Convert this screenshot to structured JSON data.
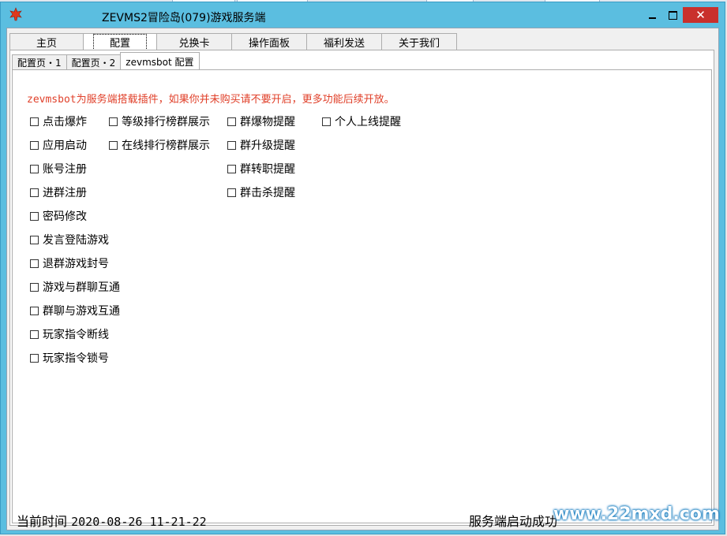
{
  "window": {
    "title": "ZEVMS2冒险岛(079)游戏服务端",
    "close_symbol": "✕"
  },
  "main_tabs": [
    {
      "label": "主页"
    },
    {
      "label": "配置"
    },
    {
      "label": "兑换卡"
    },
    {
      "label": "操作面板"
    },
    {
      "label": "福利发送"
    },
    {
      "label": "关于我们"
    }
  ],
  "sub_tabs": [
    {
      "label": "配置页・1"
    },
    {
      "label": "配置页・2"
    },
    {
      "label": "zevmsbot 配置"
    }
  ],
  "notice": "zevmsbot为服务端搭载插件，如果你并未购买请不要开启，更多功能后续开放。",
  "options": {
    "col1": [
      "点击爆炸",
      "应用启动",
      "账号注册",
      "进群注册",
      "密码修改",
      "发言登陆游戏",
      "退群游戏封号",
      "游戏与群聊互通",
      "群聊与游戏互通",
      "玩家指令断线",
      "玩家指令锁号"
    ],
    "col2": [
      "等级排行榜群展示",
      "在线排行榜群展示"
    ],
    "col3": [
      "群爆物提醒",
      "群升级提醒",
      "群转职提醒",
      "群击杀提醒"
    ],
    "col4": [
      "个人上线提醒"
    ]
  },
  "status": {
    "time_label": "当前时间",
    "time_value": "2020-08-26 11-21-22",
    "server_status": "服务端启动成功"
  },
  "watermark": "www.22mxd.com",
  "colors": {
    "title_bar": "#5bbee0",
    "notice_text": "#e0402a",
    "close_button": "#c9302c"
  }
}
